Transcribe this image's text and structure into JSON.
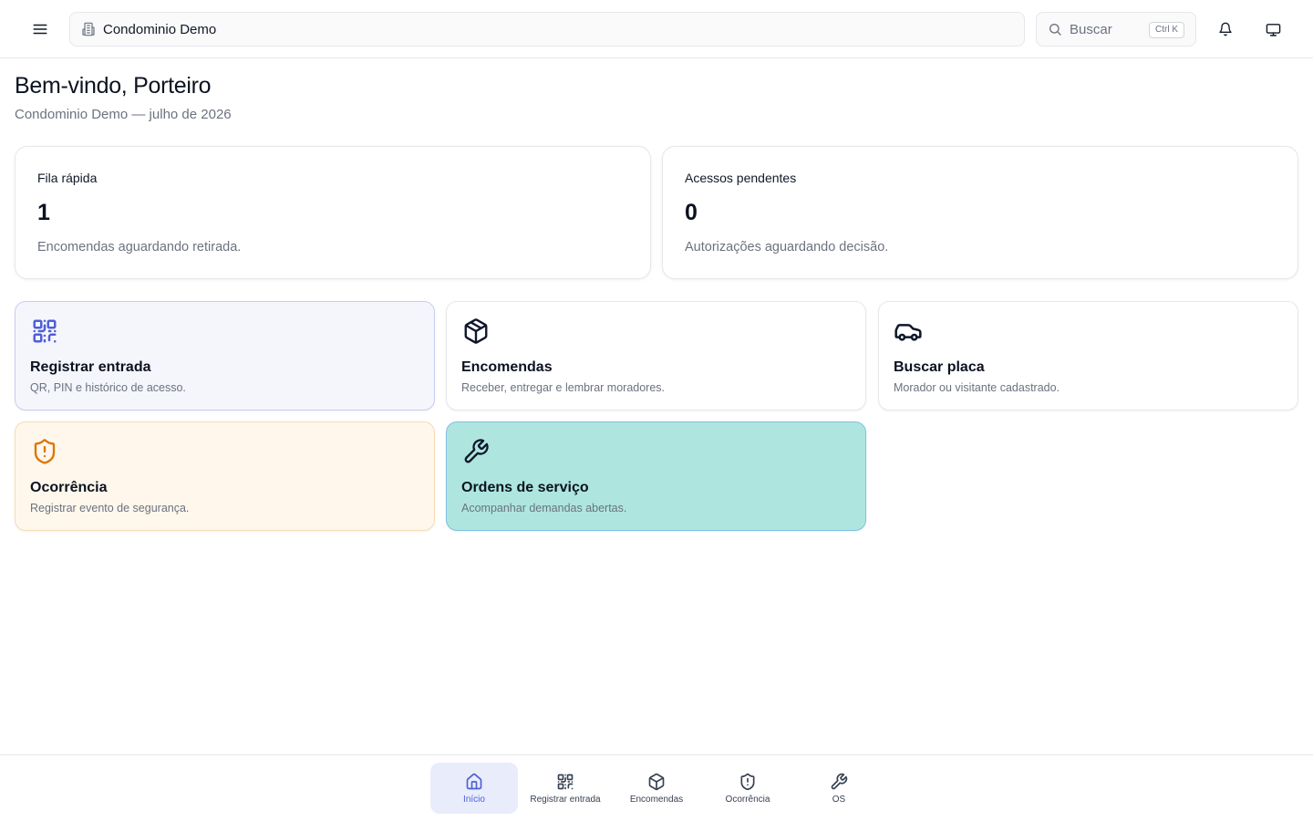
{
  "colors": {
    "accent": "#4f5fd6",
    "qr_tile_bg": "#f5f6fc",
    "occurrence_tile_bg": "#fff7ec",
    "occurrence_icon": "#d97706",
    "service_tile_bg": "#aee6df"
  },
  "topbar": {
    "menu_icon": "menu-icon",
    "condo_icon": "building-icon",
    "condo_name": "Condominio Demo",
    "search_placeholder": "Buscar",
    "search_shortcut": "Ctrl K",
    "notifications_icon": "bell-icon",
    "display_icon": "monitor-icon"
  },
  "header": {
    "title": "Bem-vindo, Porteiro",
    "subtitle": "Condominio Demo — julho de 2026"
  },
  "stats": [
    {
      "label": "Fila rápida",
      "value": "1",
      "description": "Encomendas aguardando retirada."
    },
    {
      "label": "Acessos pendentes",
      "value": "0",
      "description": "Autorizações aguardando decisão."
    }
  ],
  "actions": [
    {
      "icon": "qr-code-icon",
      "title": "Registrar entrada",
      "description": "QR, PIN e histórico de acesso."
    },
    {
      "icon": "package-icon",
      "title": "Encomendas",
      "description": "Receber, entregar e lembrar moradores."
    },
    {
      "icon": "car-icon",
      "title": "Buscar placa",
      "description": "Morador ou visitante cadastrado."
    },
    {
      "icon": "shield-alert-icon",
      "title": "Ocorrência",
      "description": "Registrar evento de segurança."
    },
    {
      "icon": "wrench-icon",
      "title": "Ordens de serviço",
      "description": "Acompanhar demandas abertas."
    }
  ],
  "bottom_nav": [
    {
      "icon": "home-icon",
      "label": "Início",
      "active": true
    },
    {
      "icon": "qr-code-icon",
      "label": "Registrar entrada",
      "active": false
    },
    {
      "icon": "package-icon",
      "label": "Encomendas",
      "active": false
    },
    {
      "icon": "shield-alert-icon",
      "label": "Ocorrência",
      "active": false
    },
    {
      "icon": "wrench-icon",
      "label": "OS",
      "active": false
    }
  ]
}
